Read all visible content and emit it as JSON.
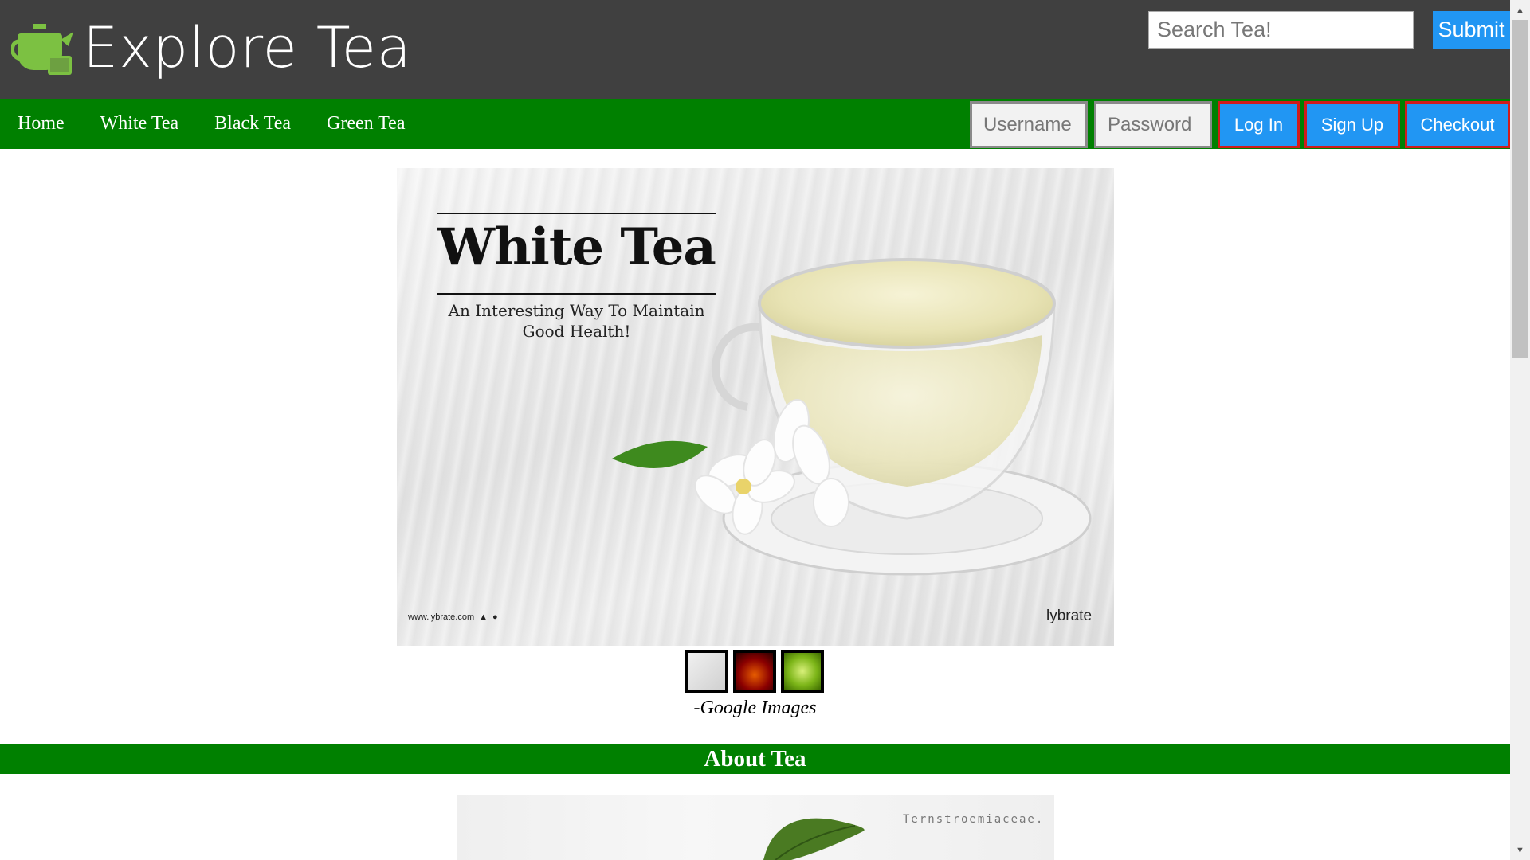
{
  "header": {
    "logo_text": "Explore Tea",
    "search_placeholder": "Search Tea!",
    "submit_label": "Submit"
  },
  "nav": {
    "links": [
      "Home",
      "White Tea",
      "Black Tea",
      "Green Tea"
    ],
    "username_placeholder": "Username",
    "password_placeholder": "Password",
    "login_label": "Log In",
    "signup_label": "Sign Up",
    "checkout_label": "Checkout"
  },
  "hero": {
    "title": "White Tea",
    "subtitle": "An Interesting Way To Maintain Good Health!",
    "footer_left": "www.lybrate.com",
    "footer_right": "lybrate"
  },
  "gallery": {
    "caption": "-Google Images",
    "thumbnails": [
      "white-tea-thumb",
      "black-tea-thumb",
      "green-tea-thumb"
    ]
  },
  "about": {
    "title": "About Tea",
    "image_label": "Ternstroemiaceae."
  },
  "colors": {
    "header_bg": "#404040",
    "nav_bg": "#008000",
    "button_blue": "#2196f3",
    "button_border": "#d11b1b",
    "logo_green": "#7cc142"
  }
}
